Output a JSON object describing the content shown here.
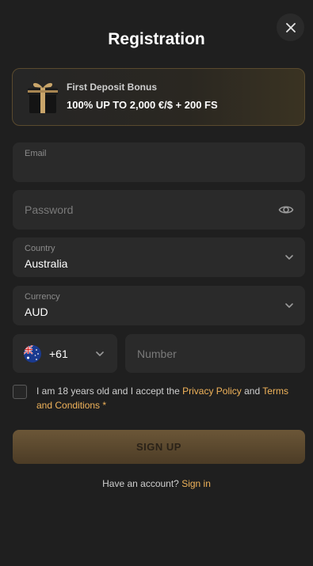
{
  "modal": {
    "title": "Registration"
  },
  "bonus": {
    "title": "First Deposit Bonus",
    "value": "100% UP TO 2,000 €/$ + 200 FS"
  },
  "form": {
    "email": {
      "label": "Email",
      "value": ""
    },
    "password": {
      "placeholder": "Password"
    },
    "country": {
      "label": "Country",
      "value": "Australia"
    },
    "currency": {
      "label": "Currency",
      "value": "AUD"
    },
    "phone": {
      "code": "+61",
      "placeholder": "Number"
    }
  },
  "terms": {
    "text_before": "I am 18 years old and I accept the ",
    "privacy_link": "Privacy Policy",
    "and_text": " and ",
    "terms_link": "Terms and Conditions",
    "required_mark": "*"
  },
  "actions": {
    "signup_label": "SIGN UP",
    "have_account_text": "Have an account?",
    "signin_link": "Sign in"
  },
  "colors": {
    "accent": "#f0b35a",
    "background": "#1f1f1f",
    "field": "#2a2a2a"
  },
  "icons": {
    "close": "close-icon",
    "gift": "gift-icon",
    "eye": "eye-icon",
    "chevron": "chevron-down-icon",
    "flag": "australia-flag-icon"
  }
}
